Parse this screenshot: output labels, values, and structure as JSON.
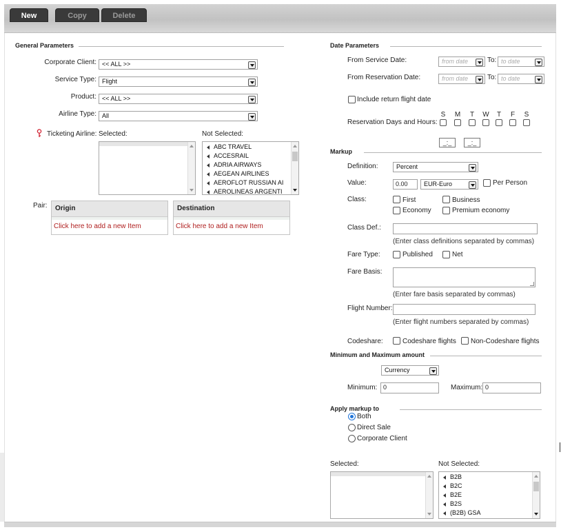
{
  "toolbar": {
    "new": "New",
    "copy": "Copy",
    "delete": "Delete"
  },
  "general": {
    "title": "General Parameters",
    "corporate_client": {
      "label": "Corporate Client:",
      "value": "<< ALL >>"
    },
    "service_type": {
      "label": "Service Type:",
      "value": "Flight"
    },
    "product": {
      "label": "Product:",
      "value": "<< ALL >>"
    },
    "airline_type": {
      "label": "Airline Type:",
      "value": "All"
    },
    "ticketing": {
      "label": "Ticketing Airline:",
      "selected_label": "Selected:",
      "not_selected_label": "Not Selected:",
      "not_selected_items": [
        "ABC TRAVEL",
        "ACCESRAIL",
        "ADRIA AIRWAYS",
        "AEGEAN AIRLINES",
        "AEROFLOT RUSSIAN AI",
        "AEROLINEAS ARGENTI"
      ]
    },
    "pair": {
      "label": "Pair:",
      "origin": "Origin",
      "destination": "Destination",
      "add_item": "Click here to add a new Item"
    }
  },
  "dates": {
    "title": "Date Parameters",
    "service_date": {
      "label": "From Service Date:",
      "from_placeholder": "from date",
      "to_label": "To:",
      "to_placeholder": "to date"
    },
    "reservation_date": {
      "label": "From Reservation Date:",
      "from_placeholder": "from date",
      "to_label": "To:",
      "to_placeholder": "to date"
    },
    "include_return": "Include return flight date",
    "reservation_days_label": "Reservation Days and Hours:",
    "days": [
      "S",
      "M",
      "T",
      "W",
      "T",
      "F",
      "S"
    ],
    "time_from": "_:_",
    "time_to": "_:_"
  },
  "markup": {
    "title": "Markup",
    "definition": {
      "label": "Definition:",
      "value": "Percent"
    },
    "value": {
      "label": "Value:",
      "amount": "0.00",
      "currency": "EUR-Euro"
    },
    "per_person": "Per Person",
    "class": {
      "label": "Class:",
      "options": [
        "First",
        "Business",
        "Economy",
        "Premium economy"
      ]
    },
    "class_def": {
      "label": "Class Def.:",
      "hint": "(Enter class definitions separated by commas)"
    },
    "fare_type": {
      "label": "Fare Type:",
      "options": [
        "Published",
        "Net"
      ]
    },
    "fare_basis": {
      "label": "Fare Basis:",
      "hint": "(Enter fare basis separated by commas)"
    },
    "flight_number": {
      "label": "Flight Number:",
      "hint": "(Enter flight numbers separated by commas)"
    },
    "codeshare": {
      "label": "Codeshare:",
      "options": [
        "Codeshare flights",
        "Non-Codeshare flights"
      ]
    }
  },
  "minmax": {
    "title": "Minimum and Maximum amount",
    "type": "Currency",
    "minimum_label": "Minimum:",
    "minimum_value": "0",
    "maximum_label": "Maximum:",
    "maximum_value": "0"
  },
  "apply": {
    "title": "Apply markup to",
    "options": [
      "Both",
      "Direct Sale",
      "Corporate Client"
    ],
    "selected_label": "Selected:",
    "not_selected_label": "Not Selected:",
    "not_selected_items": [
      "B2B",
      "B2C",
      "B2E",
      "B2S",
      "(B2B) GSA"
    ]
  }
}
